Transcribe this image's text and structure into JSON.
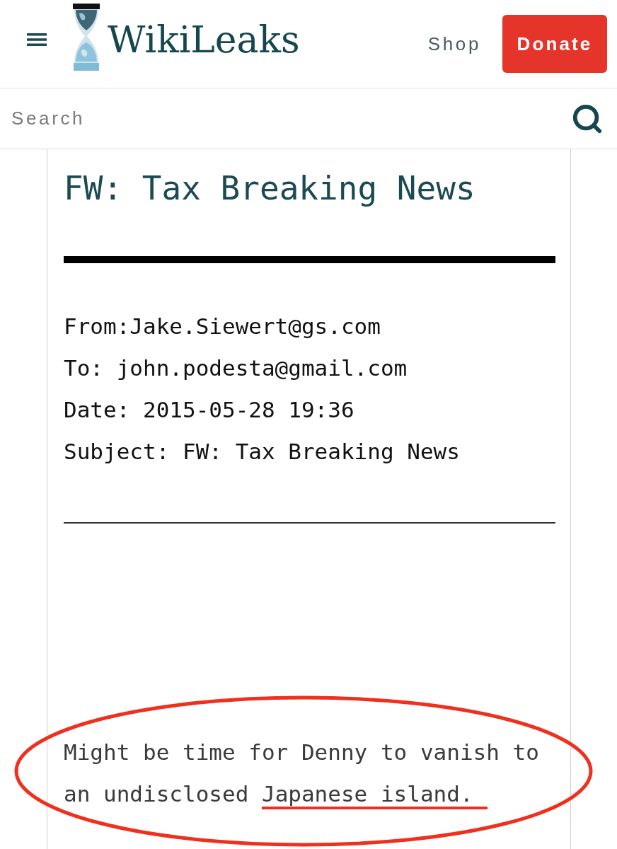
{
  "header": {
    "logo_text": "WikiLeaks",
    "nav": [
      {
        "label": "Shop",
        "kind": "link"
      },
      {
        "label": "Donate",
        "kind": "button"
      }
    ]
  },
  "search": {
    "placeholder": "Search"
  },
  "email": {
    "title": "FW: Tax Breaking News",
    "headers": [
      "From:Jake.Siewert@gs.com",
      "To: john.podesta@gmail.com",
      "Date: 2015-05-28 19:36",
      "Subject: FW: Tax Breaking News"
    ],
    "body": {
      "circled": true,
      "segments": [
        {
          "text": "Might be time for Denny to vanish to an undisclosed ",
          "underlined": false
        },
        {
          "text": "Japanese island.",
          "underlined": true
        }
      ]
    }
  }
}
